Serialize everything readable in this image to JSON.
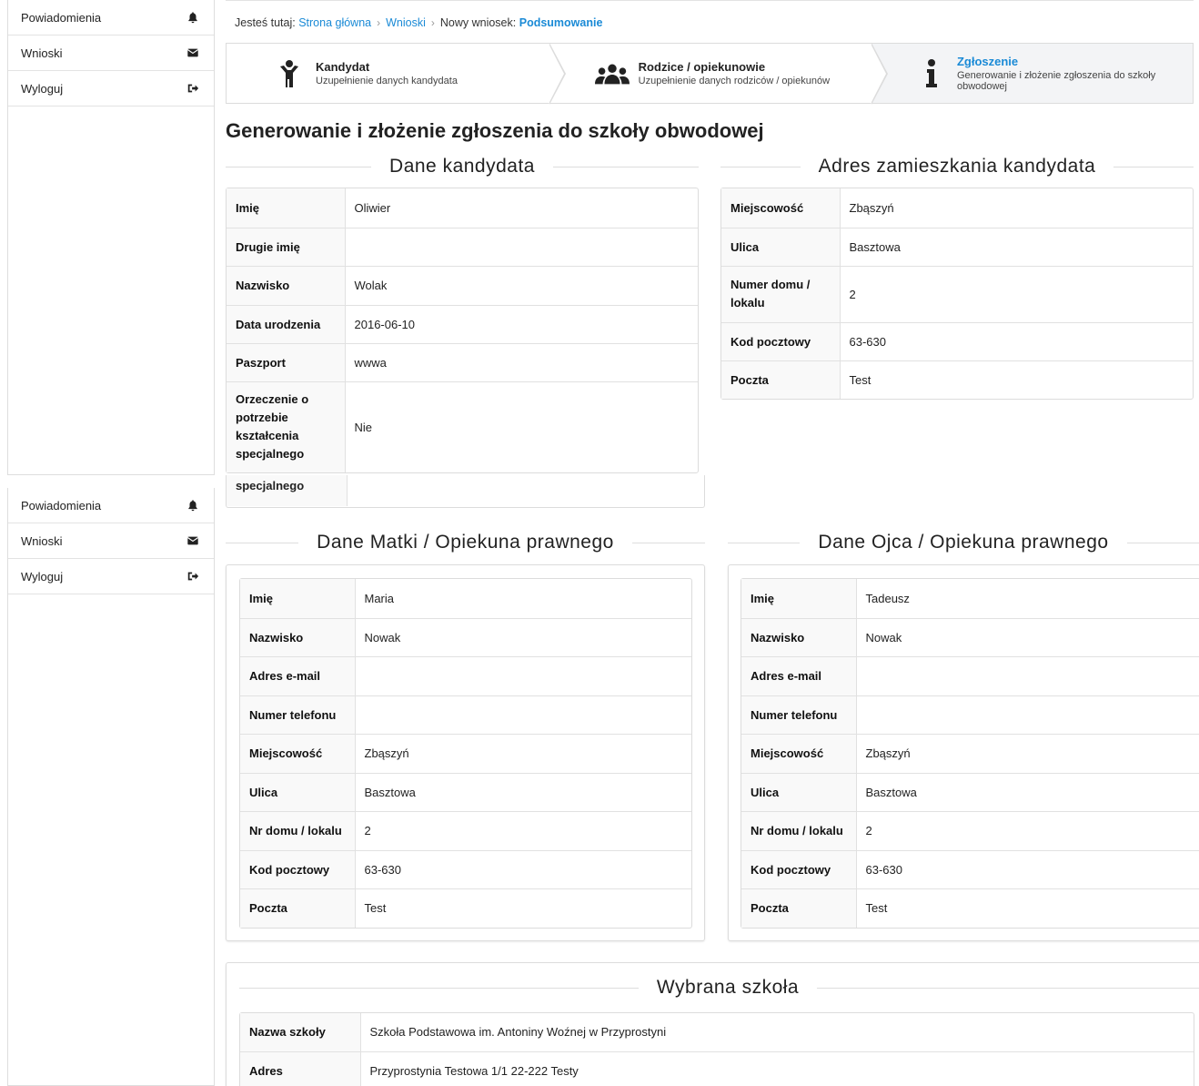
{
  "sidebar": {
    "items": [
      {
        "label": "Powiadomienia",
        "icon": "bell-icon"
      },
      {
        "label": "Wnioski",
        "icon": "envelope-icon"
      },
      {
        "label": "Wyloguj",
        "icon": "sign-out-icon"
      }
    ]
  },
  "breadcrumb": {
    "prefix": "Jesteś tutaj:",
    "home": "Strona główna",
    "requests": "Wnioski",
    "new_label": "Nowy wniosek:",
    "current": "Podsumowanie"
  },
  "wizard": {
    "steps": [
      {
        "title": "Kandydat",
        "desc": "Uzupełnienie danych kandydata",
        "icon": "child-icon"
      },
      {
        "title": "Rodzice / opiekunowie",
        "desc": "Uzupełnienie danych rodziców / opiekunów",
        "icon": "users-icon"
      },
      {
        "title": "Zgłoszenie",
        "desc": "Generowanie i złożenie zgłoszenia do szkoły obwodowej",
        "icon": "info-icon"
      }
    ]
  },
  "page_title": "Generowanie i złożenie zgłoszenia do szkoły obwodowej",
  "candidate": {
    "heading": "Dane kandydata",
    "rows": [
      {
        "k": "Imię",
        "v": "Oliwier"
      },
      {
        "k": "Drugie imię",
        "v": ""
      },
      {
        "k": "Nazwisko",
        "v": "Wolak"
      },
      {
        "k": "Data urodzenia",
        "v": "2016-06-10"
      },
      {
        "k": "Paszport",
        "v": "wwwa"
      },
      {
        "k": "Orzeczenie o potrzebie kształcenia specjalnego",
        "v": "Nie"
      }
    ],
    "overflow_fragment": "specjalnego"
  },
  "address": {
    "heading": "Adres zamieszkania kandydata",
    "rows": [
      {
        "k": "Miejscowość",
        "v": "Zbąszyń"
      },
      {
        "k": "Ulica",
        "v": "Basztowa"
      },
      {
        "k": "Numer domu / lokalu",
        "v": "2"
      },
      {
        "k": "Kod pocztowy",
        "v": "63-630"
      },
      {
        "k": "Poczta",
        "v": "Test"
      }
    ]
  },
  "mother": {
    "heading": "Dane Matki / Opiekuna prawnego",
    "rows": [
      {
        "k": "Imię",
        "v": "Maria"
      },
      {
        "k": "Nazwisko",
        "v": "Nowak"
      },
      {
        "k": "Adres e-mail",
        "v": ""
      },
      {
        "k": "Numer telefonu",
        "v": ""
      },
      {
        "k": "Miejscowość",
        "v": "Zbąszyń"
      },
      {
        "k": "Ulica",
        "v": "Basztowa"
      },
      {
        "k": "Nr domu / lokalu",
        "v": "2"
      },
      {
        "k": "Kod pocztowy",
        "v": "63-630"
      },
      {
        "k": "Poczta",
        "v": "Test"
      }
    ]
  },
  "father": {
    "heading": "Dane Ojca / Opiekuna prawnego",
    "rows": [
      {
        "k": "Imię",
        "v": "Tadeusz"
      },
      {
        "k": "Nazwisko",
        "v": "Nowak"
      },
      {
        "k": "Adres e-mail",
        "v": ""
      },
      {
        "k": "Numer telefonu",
        "v": ""
      },
      {
        "k": "Miejscowość",
        "v": "Zbąszyń"
      },
      {
        "k": "Ulica",
        "v": "Basztowa"
      },
      {
        "k": "Nr domu / lokalu",
        "v": "2"
      },
      {
        "k": "Kod pocztowy",
        "v": "63-630"
      },
      {
        "k": "Poczta",
        "v": "Test"
      }
    ]
  },
  "school": {
    "heading": "Wybrana szkoła",
    "rows": [
      {
        "k": "Nazwa szkoły",
        "v": "Szkoła Podstawowa im. Antoniny Woźnej w Przyprostyni"
      },
      {
        "k": "Adres",
        "v": "Przyprostynia Testowa 1/1 22-222 Testy"
      }
    ]
  },
  "colors": {
    "accent": "#1a8ad6",
    "border": "#dcdcdc",
    "key_bg": "#f9f9f9"
  }
}
